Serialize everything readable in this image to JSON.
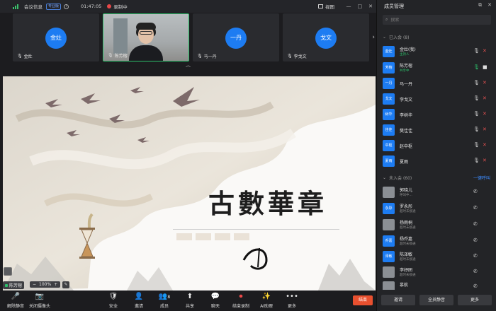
{
  "topbar": {
    "meeting_title": "会议信息",
    "badge": "专业版",
    "info": "i",
    "elapsed": "01:47:05",
    "recording": "录制中",
    "view_label": "视图",
    "min": "—",
    "max": "□",
    "close": "✕"
  },
  "strip": {
    "tiles": [
      {
        "avatar": "金灶",
        "name": "金灶"
      },
      {
        "name": "陈芳榕"
      },
      {
        "avatar": "一丹",
        "name": "马一丹"
      },
      {
        "avatar": "戈文",
        "name": "李戈文"
      }
    ]
  },
  "slide": {
    "title": "古數華章"
  },
  "share": {
    "presenter": "陈芳榕",
    "zoom": "100%",
    "zoom_minus": "−",
    "zoom_plus": "+",
    "pen": "✎"
  },
  "toolbar": {
    "items": [
      {
        "icon": "🎤",
        "label": "解除静音"
      },
      {
        "icon": "📷",
        "label": "关闭摄像头"
      },
      {
        "icon": "🛡",
        "label": "安全"
      },
      {
        "icon": "👤",
        "label": "邀请"
      },
      {
        "icon": "👥",
        "label": "成员",
        "count": "8"
      },
      {
        "icon": "⬆",
        "label": "共享"
      },
      {
        "icon": "💬",
        "label": "聊天"
      },
      {
        "icon": "⏺",
        "label": "结束录制"
      },
      {
        "icon": "✨",
        "label": "AI助理"
      },
      {
        "icon": "•••",
        "label": "更多"
      }
    ],
    "end_label": "结束"
  },
  "panel": {
    "title": "成员管理",
    "search_placeholder": "搜索",
    "joined_label": "已入会 (8)",
    "notjoined_label": "未入会 (60)",
    "call_all": "一键呼叫",
    "joined": [
      {
        "avatar": "金灶",
        "name": "金灶(我)",
        "sub": "主持人",
        "sub_color": "green"
      },
      {
        "avatar": "芳榕",
        "name": "陈芳榕",
        "sub": "共享中",
        "sub_color": "green"
      },
      {
        "avatar": "一丹",
        "name": "马一丹"
      },
      {
        "avatar": "戈文",
        "name": "李戈文"
      },
      {
        "avatar": "树华",
        "name": "李树华"
      },
      {
        "avatar": "佳佳",
        "name": "樊佳佳"
      },
      {
        "avatar": "中枢",
        "name": "赵中枢"
      },
      {
        "avatar": "夏雨",
        "name": "夏雨"
      }
    ],
    "notjoined": [
      {
        "avatar": "",
        "name": "郭晓儿",
        "sub": "呼叫中...",
        "img": true
      },
      {
        "avatar": "永彤",
        "name": "罗永彤",
        "sub": "超时未接通"
      },
      {
        "avatar": "",
        "name": "杨雨桐",
        "sub": "超时未接通",
        "img": true
      },
      {
        "avatar": "乔嘉",
        "name": "杨乔嘉",
        "sub": "超时未接通"
      },
      {
        "avatar": "泽敏",
        "name": "陈泽敏",
        "sub": "超时未接通"
      },
      {
        "avatar": "",
        "name": "李妤囲",
        "sub": "超时未接通",
        "img": true
      },
      {
        "avatar": "",
        "name": "慕航",
        "sub": "",
        "img": true
      }
    ],
    "buttons": [
      "邀请",
      "全员静音",
      "更多"
    ]
  }
}
